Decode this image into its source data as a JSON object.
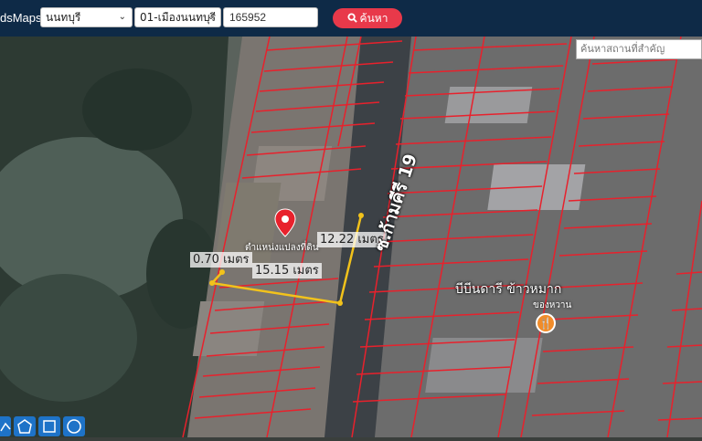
{
  "header": {
    "brand": "dsMaps",
    "province": "นนทบุรี",
    "district": "01-เมืองนนทบุรี",
    "deed_no": "165952",
    "search_label": "ค้นหา"
  },
  "map": {
    "place_search_placeholder": "ค้นหาสถานที่สำคัญ",
    "street_label": "ซ.ก้ามคีรี 19",
    "measure_1": "12.22 เมตร",
    "measure_2": "15.15 เมตร",
    "measure_3": "0.70 เมตร",
    "pin_label": "ตำแหน่งแปลงที่ดิน",
    "place_label": "บีบีนดารี ข้าวหมาก",
    "place_sub": "ของหวาน"
  },
  "colors": {
    "topbar": "#0e2a47",
    "search_button": "#e8394a",
    "parcel_lines": "#e8212c",
    "measure_line": "#f2c21b",
    "tool_button": "#1e73c8"
  },
  "icons": [
    "search-icon",
    "location-pin-icon",
    "restaurant-icon",
    "polyline-icon",
    "polygon-icon",
    "rectangle-icon",
    "circle-icon"
  ]
}
